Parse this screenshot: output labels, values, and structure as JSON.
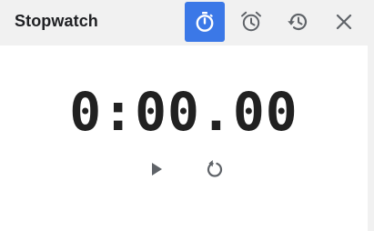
{
  "header": {
    "title": "Stopwatch",
    "buttons": [
      {
        "icon": "stopwatch-icon",
        "active": true
      },
      {
        "icon": "alarm-icon",
        "active": false
      },
      {
        "icon": "history-icon",
        "active": false
      },
      {
        "icon": "close-icon",
        "active": false
      }
    ]
  },
  "main": {
    "time": "0:00.00",
    "controls": [
      {
        "icon": "play-icon"
      },
      {
        "icon": "reset-icon"
      }
    ]
  },
  "colors": {
    "accent": "#3b78e7",
    "header_bg": "#f1f1f1",
    "content_bg": "#ffffff",
    "text": "#212121",
    "icon": "#5f6368"
  }
}
